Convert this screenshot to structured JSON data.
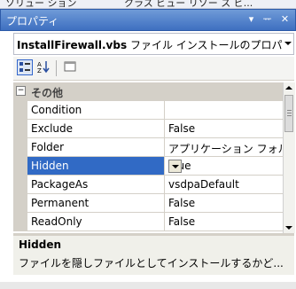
{
  "top_tabs": {
    "left": "ソリュー ション",
    "right": "クラス ビュー   リソー ス ビ..."
  },
  "panel": {
    "title": "プロパティ",
    "pin_icon": "ᅲ",
    "close_icon": "✕",
    "menu_icon": "▾"
  },
  "object_selector": {
    "name": "InstallFirewall.vbs",
    "type": "ファイル インストールのプロパ"
  },
  "toolbar": {
    "categorized": "categorized-icon",
    "alphabetical": "alphabetical-icon",
    "pages": "property-pages-icon"
  },
  "category": {
    "label": "その他",
    "toggle": "⊟"
  },
  "properties": [
    {
      "name": "Condition",
      "value": ""
    },
    {
      "name": "Exclude",
      "value": "False"
    },
    {
      "name": "Folder",
      "value": "アプリケーション フォルダ"
    },
    {
      "name": "Hidden",
      "value": "True",
      "selected": true
    },
    {
      "name": "PackageAs",
      "value": "vsdpaDefault"
    },
    {
      "name": "Permanent",
      "value": "False"
    },
    {
      "name": "ReadOnly",
      "value": "False"
    }
  ],
  "description": {
    "title": "Hidden",
    "text": "ファイルを隠しファイルとしてインストールするかど..."
  },
  "colors": {
    "title_bar": "#3e6fc0",
    "selection": "#316ac5",
    "margin": "#d4d0c8"
  }
}
